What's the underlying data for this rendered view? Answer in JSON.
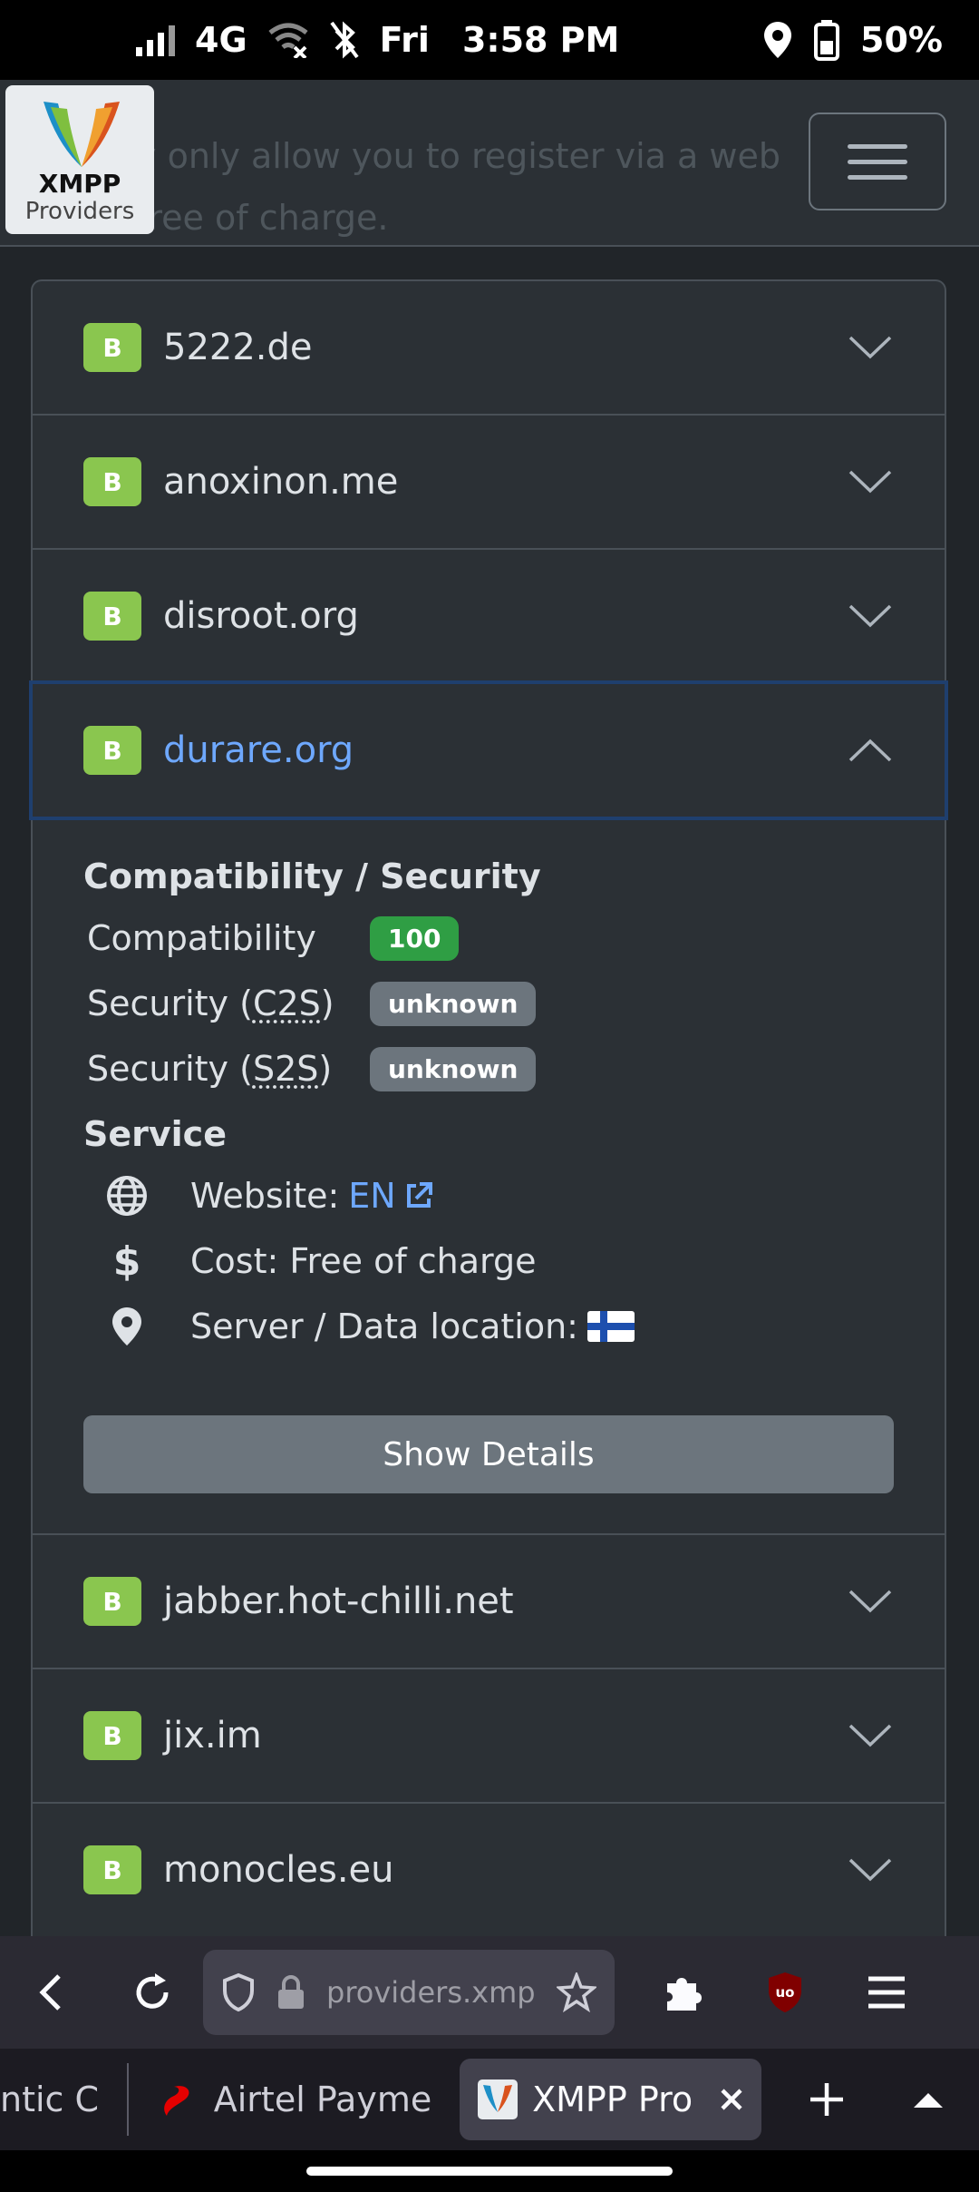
{
  "status_bar": {
    "network": "4G",
    "day": "Fri",
    "time": "3:58 PM",
    "battery": "50%"
  },
  "header": {
    "logo_title": "XMPP",
    "logo_subtitle": "Providers",
    "background_text_line1": "y only allow you to register via a web",
    "background_text_line2": "free of charge."
  },
  "providers": [
    {
      "badge": "B",
      "name": "5222.de",
      "open": false
    },
    {
      "badge": "B",
      "name": "anoxinon.me",
      "open": false
    },
    {
      "badge": "B",
      "name": "disroot.org",
      "open": false
    },
    {
      "badge": "B",
      "name": "durare.org",
      "open": true
    },
    {
      "badge": "B",
      "name": "jabber.hot-chilli.net",
      "open": false
    },
    {
      "badge": "B",
      "name": "jix.im",
      "open": false
    },
    {
      "badge": "B",
      "name": "monocles.eu",
      "open": false
    }
  ],
  "details": {
    "compat_heading": "Compatibility / Security",
    "compatibility_label": "Compatibility",
    "compatibility_value": "100",
    "c2s_label_prefix": "Security (",
    "c2s_abbr": "C2S",
    "c2s_label_suffix": ")",
    "c2s_value": "unknown",
    "s2s_label_prefix": "Security (",
    "s2s_abbr": "S2S",
    "s2s_label_suffix": ")",
    "s2s_value": "unknown",
    "service_heading": "Service",
    "website_label": "Website:",
    "website_link": "EN",
    "cost_label": "Cost: Free of charge",
    "location_label": "Server / Data location:",
    "show_details_button": "Show Details"
  },
  "browser": {
    "url": "providers.xmpp.net",
    "tabs": [
      {
        "label": "ntic C",
        "active": false
      },
      {
        "label": "Airtel Payme",
        "active": false
      },
      {
        "label": "XMPP Pro",
        "active": true
      }
    ]
  }
}
